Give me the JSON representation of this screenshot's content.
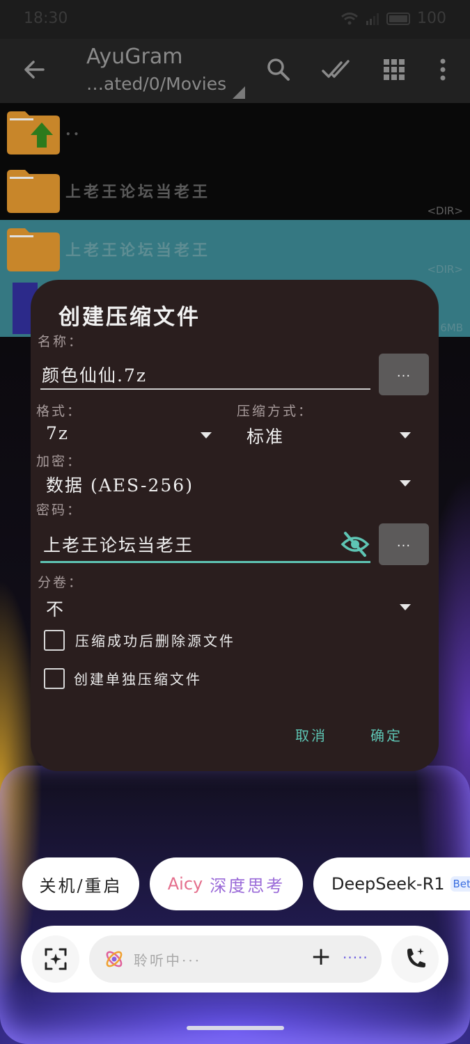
{
  "status_bar": {
    "time": "18:30",
    "battery": "100"
  },
  "toolbar": {
    "title": "AyuGram",
    "path": "…ated/0/Movies"
  },
  "files": [
    {
      "name": "..",
      "tag": ""
    },
    {
      "name": "上老王论坛当老王",
      "tag": "<DIR>"
    },
    {
      "name": "上老王论坛当老王",
      "tag": "<DIR>"
    },
    {
      "name": "",
      "tag": "6MB"
    }
  ],
  "dialog": {
    "title": "创建压缩文件",
    "name_label": "名称：",
    "name_value": "颜色仙仙.7z",
    "browse_label": "...",
    "format_label": "格式：",
    "format_value": "7z",
    "method_label": "压缩方式：",
    "method_value": "标准",
    "encrypt_label": "加密：",
    "encrypt_value": "数据 (AES-256)",
    "password_label": "密码：",
    "password_value": "上老王论坛当老王",
    "volume_label": "分卷：",
    "volume_value": "不",
    "delete_source_label": "压缩成功后删除源文件",
    "delete_source_checked": false,
    "separate_archive_label": "创建单独压缩文件",
    "separate_archive_checked": false,
    "cancel_label": "取消",
    "ok_label": "确定"
  },
  "chips": {
    "shutdown": "关机/重启",
    "aicy_a": "Aicy",
    "aicy_b": "深度思考",
    "deepseek": "DeepSeek-R1",
    "beta": "Beta"
  },
  "assistant_bar": {
    "listening": "聆听中···",
    "plus": "+",
    "dots": "·····"
  },
  "colors": {
    "accent": "#5ec5b4",
    "dialog_bg": "#2a1e1e",
    "selected_row": "#357882",
    "folder": "#c8862a"
  }
}
